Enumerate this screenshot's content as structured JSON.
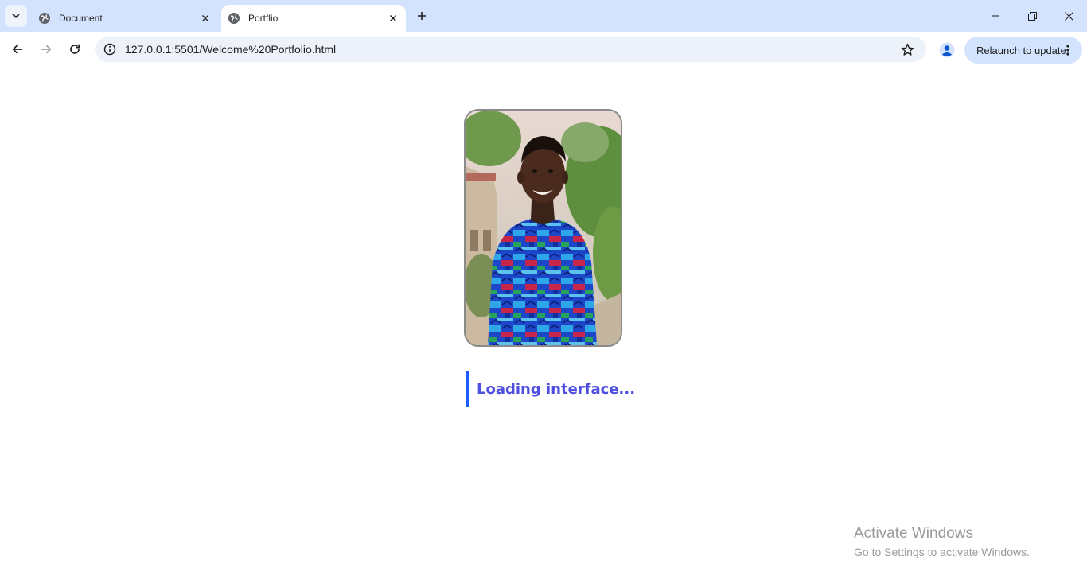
{
  "browser": {
    "tabs": [
      {
        "title": "Document",
        "active": false,
        "icon": "globe-icon"
      },
      {
        "title": "Portflio",
        "active": true,
        "icon": "globe-icon"
      }
    ],
    "url": "127.0.0.1:5501/Welcome%20Portfolio.html",
    "relaunch_label": "Relaunch to update",
    "accent_color": "#d3e3fd"
  },
  "page": {
    "loading_text": "Loading interface...",
    "loading_text_color": "#4e4fe0",
    "loading_bar_color": "#1a5cff"
  },
  "watermark": {
    "title": "Activate Windows",
    "subtitle": "Go to Settings to activate Windows."
  }
}
